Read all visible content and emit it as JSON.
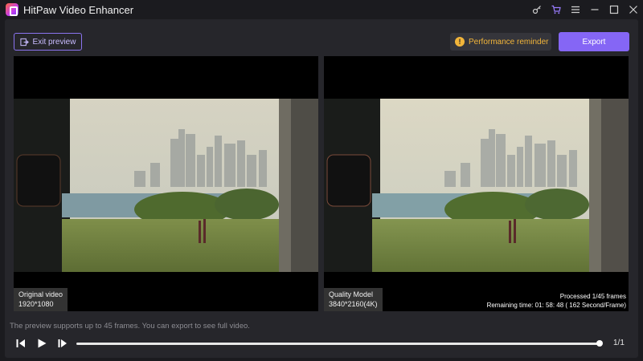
{
  "app": {
    "title": "HitPaw Video Enhancer"
  },
  "titlebar_icons": [
    "key-icon",
    "cart-icon",
    "menu-icon",
    "minimize-icon",
    "maximize-icon",
    "close-icon"
  ],
  "toolbar": {
    "exit_label": "Exit preview",
    "performance_label": "Performance reminder",
    "export_label": "Export"
  },
  "left_pane": {
    "title": "Original video",
    "resolution": "1920*1080"
  },
  "right_pane": {
    "title": "Quality Model",
    "resolution": "3840*2160(4K)",
    "processed": "Processed 1/45 frames",
    "remaining": "Remaining time: 01: 58: 48 ( 162 Second/Frame)"
  },
  "notice": "The preview supports up to 45 frames. You can export to see full video.",
  "player": {
    "page": "1/1",
    "progress": 1.0
  },
  "colors": {
    "accent": "#8566f5",
    "warning": "#f2b53a",
    "panel": "#26262b",
    "background": "#1b1b1f"
  }
}
